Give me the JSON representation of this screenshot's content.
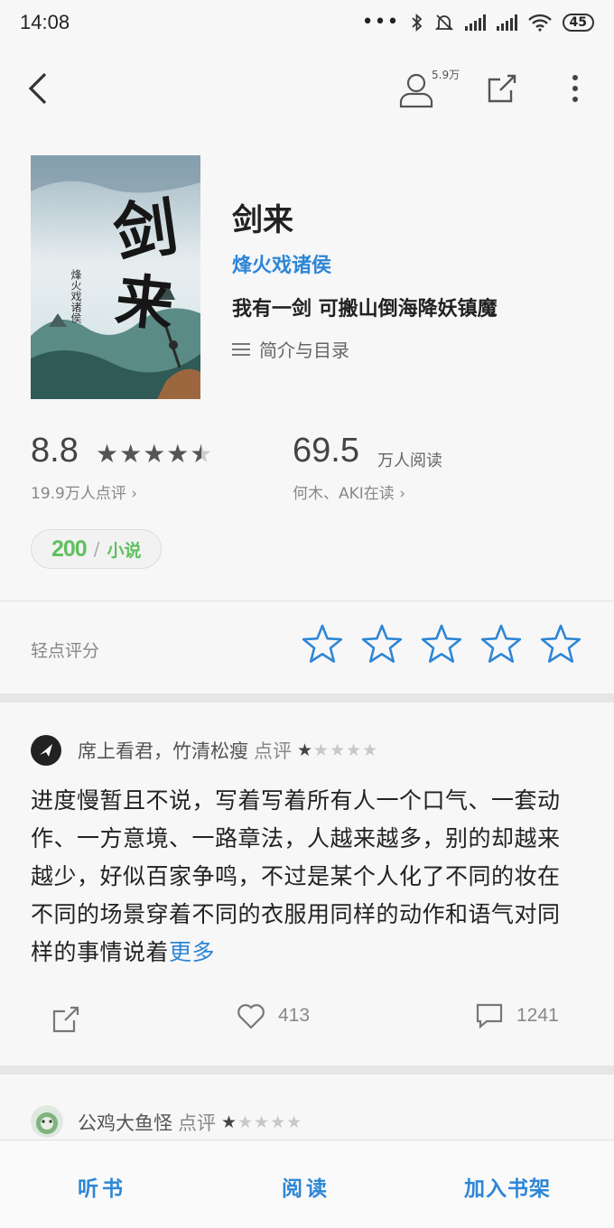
{
  "status_bar": {
    "time": "14:08",
    "battery": "45",
    "icons": [
      "more-dots-icon",
      "bluetooth-icon",
      "mute-bell-icon",
      "signal-icon",
      "signal-icon",
      "wifi-icon",
      "battery-icon"
    ]
  },
  "header": {
    "readers_count": "5.9万",
    "icons": [
      "back-icon",
      "person-icon",
      "share-icon",
      "more-vertical-icon"
    ]
  },
  "book": {
    "title": "剑来",
    "author": "烽火戏诸侯",
    "slogan": "我有一剑 可搬山倒海降妖镇魔",
    "toc_label": "简介与目录",
    "cover": {
      "calligraphy": "剑来",
      "side_text": "烽火戏诸侯"
    }
  },
  "stats": {
    "rating": "8.8",
    "rating_value": 4.5,
    "rating_count": "19.9万人点评",
    "read_number": "69.5",
    "read_unit": "万人阅读",
    "readers_text": "何木、AKI在读"
  },
  "tag": {
    "number": "200",
    "separator": "/",
    "label": "小说"
  },
  "rate": {
    "label": "轻点评分",
    "stars": 5
  },
  "reviews": [
    {
      "author": "席上看君，竹清松瘦",
      "action": "点评",
      "stars": 1,
      "max_stars": 5,
      "body": "进度慢暂且不说，写着写着所有人一个口气、一套动作、一方意境、一路章法，人越来越多，别的却越来越少，好似百家争鸣，不过是某个人化了不同的妆在不同的场景穿着不同的衣服用同样的动作和语气对同样的事情说着",
      "more": "更多",
      "likes": "413",
      "comments": "1241"
    },
    {
      "author": "公鸡大鱼怪",
      "action": "点评",
      "stars": 1,
      "max_stars": 5
    }
  ],
  "bottom_bar": {
    "listen": "听书",
    "read": "阅读",
    "add_shelf": "加入书架"
  },
  "colors": {
    "accent": "#2e86d6",
    "tag_green": "#5fc05f",
    "background": "#f7f7f7"
  }
}
